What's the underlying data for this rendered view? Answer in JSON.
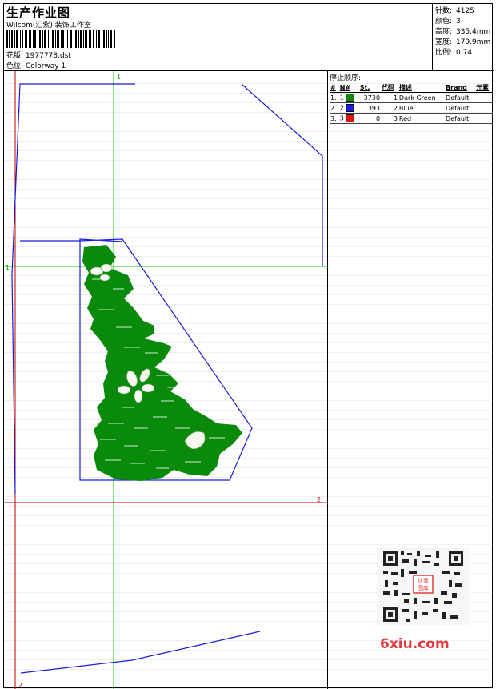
{
  "header": {
    "title": "生产作业图",
    "company": "Wilcom(汇紫) 装饰工作室",
    "design_label": "花版:",
    "design_value": "1977778.dst",
    "colorway_label": "色位:",
    "colorway_value": "Colorway 1"
  },
  "stats": [
    {
      "label": "针数:",
      "value": "4125"
    },
    {
      "label": "颜色:",
      "value": "3"
    },
    {
      "label": "高度:",
      "value": "335.4mm"
    },
    {
      "label": "宽度:",
      "value": "179.9mm"
    },
    {
      "label": "比例:",
      "value": "0.74"
    }
  ],
  "canvas": {
    "axis_top": "1",
    "axis_left": "1",
    "axis_right": "2",
    "axis_bottom": "2",
    "colors": {
      "guide_green": "#00d000",
      "guide_red": "#c00000",
      "outline_blue": "#1a1adb",
      "fill_green": "#0a8a0a"
    }
  },
  "stops": {
    "title": "停止顺序:",
    "columns": [
      "#",
      "N#",
      "St.",
      "代码",
      "描述",
      "Brand",
      "元素"
    ],
    "rows": [
      {
        "idx": "1.",
        "n": "1",
        "color": "#0a8a0a",
        "st": "3730",
        "code": "1",
        "desc": "Dark Green",
        "brand": "Default"
      },
      {
        "idx": "2.",
        "n": "2",
        "color": "#1a1adb",
        "st": "393",
        "code": "2",
        "desc": "Blue",
        "brand": "Default"
      },
      {
        "idx": "3.",
        "n": "3",
        "color": "#e01010",
        "st": "0",
        "code": "3",
        "desc": "Red",
        "brand": "Default"
      }
    ]
  },
  "watermark": {
    "text": "6xiu.com",
    "qr_caption": "炫我图库",
    "qr_icon": "qr-code-icon"
  }
}
